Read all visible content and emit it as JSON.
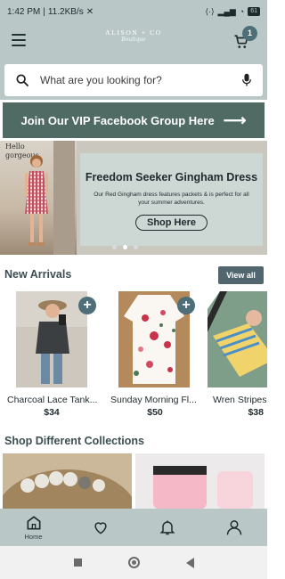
{
  "status_bar": {
    "time": "1:42 PM",
    "speed": "11.2KB/s",
    "battery": "61"
  },
  "header": {
    "logo_line1": "ALISON + CO",
    "logo_line2": "Boutique",
    "cart_count": "1",
    "search_placeholder": "What are you looking for?"
  },
  "vip_banner": {
    "label": "Join Our VIP Facebook Group Here",
    "arrow": "⟶"
  },
  "hero": {
    "photo_text_1": "Hello",
    "photo_text_2": "gorgeous",
    "title": "Freedom Seeker Gingham Dress",
    "description": "Our Red Gingham dress features packets & is perfect for all your summer adventures.",
    "button": "Shop Here",
    "slide_index": 2,
    "slide_count": 3
  },
  "new_arrivals": {
    "title": "New Arrivals",
    "view_all": "View all",
    "products": [
      {
        "name": "Charcoal Lace Tank...",
        "price": "$34",
        "plus": "+"
      },
      {
        "name": "Sunday Morning Fl...",
        "price": "$50",
        "plus": "+"
      },
      {
        "name": "Wren Stripes",
        "price": "$38"
      }
    ]
  },
  "collections": {
    "title": "Shop Different Collections"
  },
  "bottom_nav": {
    "items": [
      {
        "label": "Home",
        "icon": "home-icon"
      },
      {
        "label": "",
        "icon": "heart-icon"
      },
      {
        "label": "",
        "icon": "bell-icon"
      },
      {
        "label": "",
        "icon": "user-icon"
      }
    ]
  },
  "colors": {
    "header_bg": "#b9c8c6",
    "accent": "#4e6e7a",
    "vip_bg": "#4f6b63"
  }
}
